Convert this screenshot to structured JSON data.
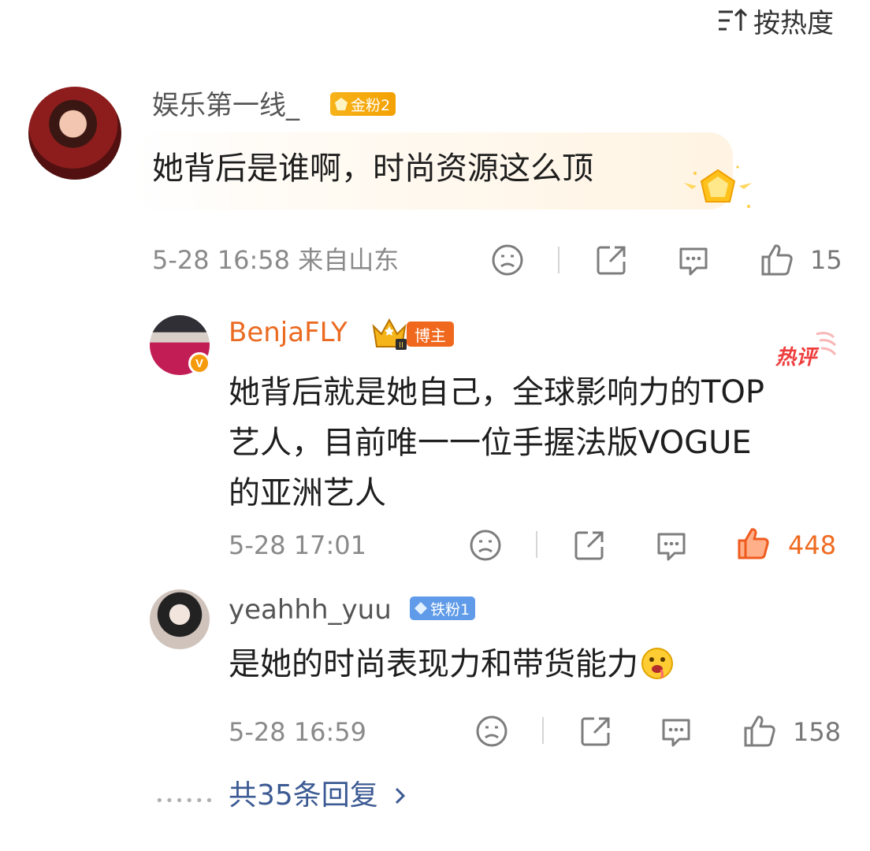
{
  "sort": {
    "label": "按热度",
    "icon": "sort-icon"
  },
  "comment": {
    "username": "娱乐第一线_",
    "fan_badge": "金粉2",
    "text": "她背后是谁啊，时尚资源这么顶",
    "time_location": "5-28 16:58  来自山东",
    "likes": "15"
  },
  "replies": [
    {
      "username": "BenjaFLY",
      "role_badge": "博主",
      "hot_label": "热评",
      "text": "她背后就是她自己，全球影响力的TOP艺人，目前唯一一位手握法版VOGUE的亚洲艺人",
      "time": "5-28 17:01",
      "likes": "448"
    },
    {
      "username": "yeahhh_yuu",
      "fan_badge": "铁粉1",
      "text": "是她的时尚表现力和带货能力",
      "time": "5-28 16:59",
      "likes": "158"
    }
  ],
  "more_replies": "共35条回复",
  "colors": {
    "blogger_orange": "#eb6a21",
    "link_blue": "#3c5a93",
    "gold_badge": "#f5a90a",
    "iron_badge": "#5f9be8"
  }
}
